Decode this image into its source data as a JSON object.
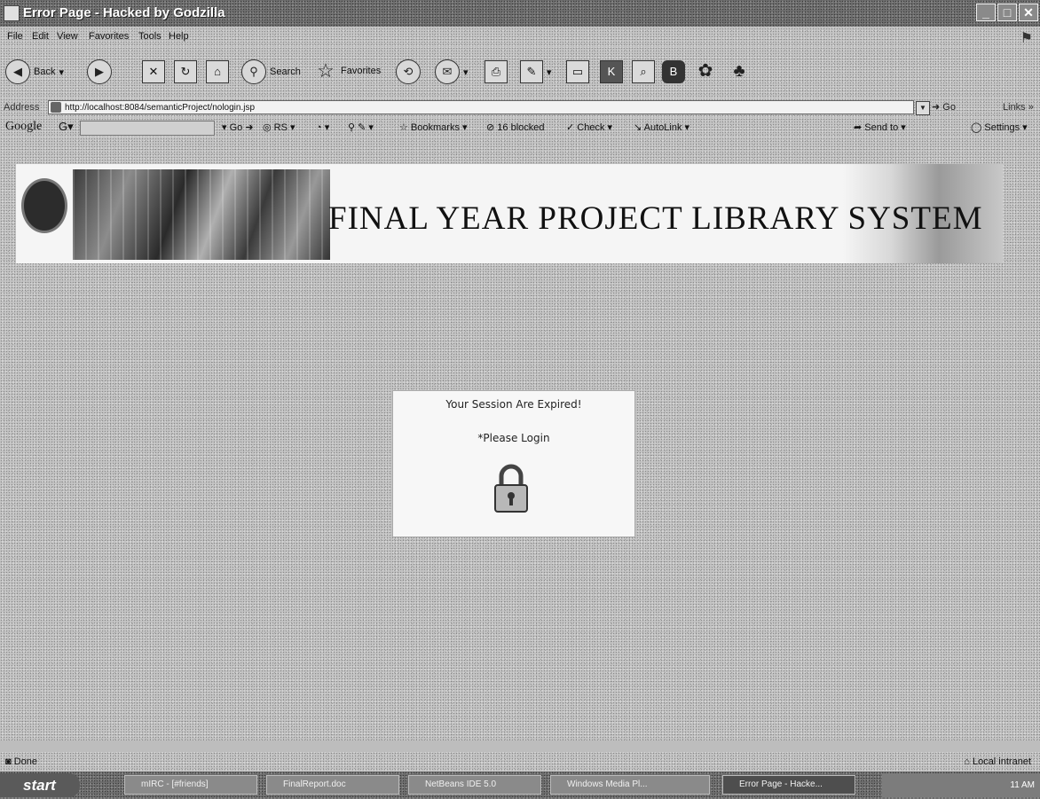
{
  "window": {
    "title": "Error Page - Hacked by Godzilla"
  },
  "menu": [
    "File",
    "Edit",
    "View",
    "Favorites",
    "Tools",
    "Help"
  ],
  "toolbar": {
    "back": "Back",
    "search": "Search",
    "favorites": "Favorites"
  },
  "address": {
    "label": "Address",
    "url": "http://localhost:8084/semanticProject/nologin.jsp",
    "go": "Go",
    "links": "Links"
  },
  "googlebar": {
    "logo": "Google",
    "go": "Go",
    "rs": "RS",
    "bookmarks": "Bookmarks",
    "blocked": "16 blocked",
    "check": "Check",
    "autolink": "AutoLink",
    "sendto": "Send to",
    "settings": "Settings"
  },
  "page": {
    "banner_title": "FINAL YEAR PROJECT LIBRARY SYSTEM",
    "message_line1": "Your Session Are Expired!",
    "message_line2": "*Please Login"
  },
  "status": {
    "left": "Done",
    "zone": "Local intranet"
  },
  "taskbar": {
    "start": "start",
    "tasks": [
      "mIRC - [#friends]",
      "FinalReport.doc",
      "NetBeans IDE 5.0",
      "Windows Media Pl...",
      "Error Page - Hacke..."
    ],
    "clock": "11 AM"
  }
}
